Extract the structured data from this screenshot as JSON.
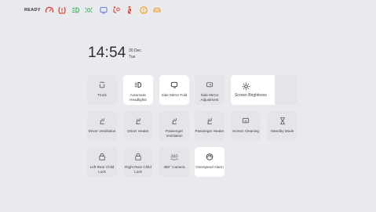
{
  "status": {
    "gear": "READY",
    "icons": [
      {
        "name": "speed-limit-icon",
        "color": "#e0463a"
      },
      {
        "name": "tire-pressure-icon",
        "color": "#e0463a"
      },
      {
        "name": "headlight-icon",
        "color": "#3bb55a"
      },
      {
        "name": "position-light-icon",
        "color": "#3bb55a"
      },
      {
        "name": "display-icon",
        "color": "#6a86d8"
      },
      {
        "name": "airbag-icon",
        "color": "#e0463a"
      },
      {
        "name": "seatbelt-icon",
        "color": "#e0463a"
      },
      {
        "name": "warning-icon",
        "color": "#f2a21b"
      },
      {
        "name": "car-icon",
        "color": "#f2a21b"
      }
    ]
  },
  "clock": {
    "time": "14:54",
    "date": "30 Dec",
    "weekday": "Tue"
  },
  "tiles": [
    {
      "label": "Trunk",
      "icon": "trunk-icon",
      "active": false
    },
    {
      "label": "Automatic Headlights",
      "icon": "headlight-auto-icon",
      "active": true
    },
    {
      "label": "Side Mirror Fold",
      "icon": "mirror-fold-icon",
      "active": true
    },
    {
      "label": "Side Mirror Adjustment",
      "icon": "mirror-adjust-icon",
      "active": false
    },
    {
      "label": "Screen Brightness",
      "icon": "brightness-icon",
      "active": false,
      "level_percent": 66
    },
    {
      "label": "Driver Ventilation",
      "icon": "seat-vent-icon",
      "active": false
    },
    {
      "label": "Driver Heater",
      "icon": "seat-heat-icon",
      "active": false
    },
    {
      "label": "Passenger Ventilation",
      "icon": "seat-vent-icon",
      "active": false
    },
    {
      "label": "Passenger Heater",
      "icon": "seat-heat-icon",
      "active": false
    },
    {
      "label": "Screen Cleaning",
      "icon": "screen-clean-icon",
      "active": false
    },
    {
      "label": "Standby Mode",
      "icon": "hourglass-icon",
      "active": false
    },
    {
      "label": "Left Rear Child Lock",
      "icon": "child-lock-icon",
      "active": false
    },
    {
      "label": "Right Rear Child Lock",
      "icon": "child-lock-icon",
      "active": false
    },
    {
      "label": "360° Camera",
      "icon": "camera-360-icon",
      "active": false,
      "icon_text": "360"
    },
    {
      "label": "Overspeed Alarm",
      "icon": "overspeed-alarm-icon",
      "active": true
    }
  ]
}
